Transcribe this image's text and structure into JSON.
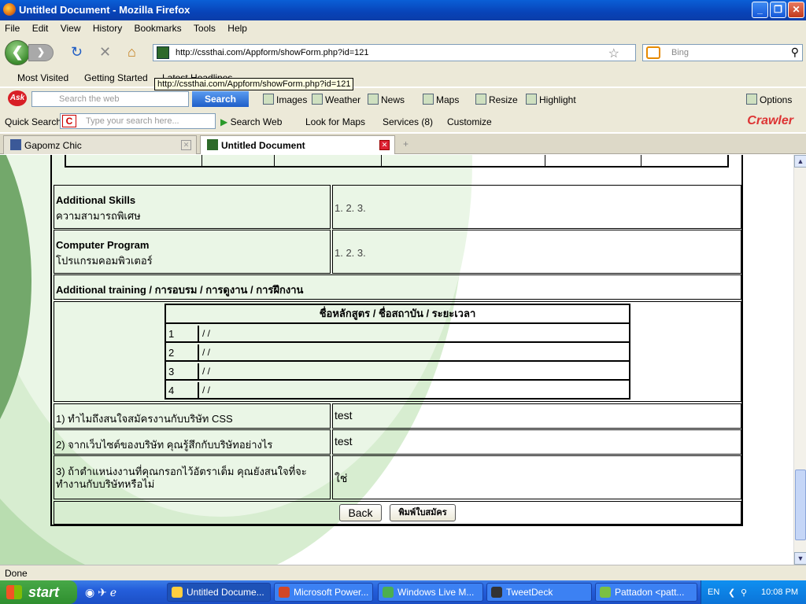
{
  "window": {
    "title": "Untitled Document - Mozilla Firefox"
  },
  "menu": [
    "File",
    "Edit",
    "View",
    "History",
    "Bookmarks",
    "Tools",
    "Help"
  ],
  "nav": {
    "url": "http://cssthai.com/Appform/showForm.php?id=121",
    "search_placeholder": "Bing"
  },
  "bookmarks": {
    "most_visited": "Most Visited",
    "getting_started": "Getting Started",
    "latest_headlines": "Latest Headlines"
  },
  "tooltip": "http://cssthai.com/Appform/showForm.php?id=121",
  "ask_toolbar": {
    "placeholder": "Search the web",
    "search_button": "Search",
    "items": [
      "Images",
      "Weather",
      "News",
      "Maps",
      "Resize",
      "Highlight",
      "Options"
    ]
  },
  "quick_search": {
    "label": "Quick Search:",
    "placeholder": "Type your search here...",
    "items": [
      "Search Web",
      "Look for Maps",
      "Services (8)",
      "Customize"
    ],
    "brand": "Crawler"
  },
  "tabs": [
    {
      "label": "Gapomz Chic",
      "active": false
    },
    {
      "label": "Untitled Document",
      "active": true
    }
  ],
  "form": {
    "additional_skills": {
      "label_en": "Additional Skills",
      "label_th": "ความสามารถพิเศษ",
      "value": "1. 2. 3."
    },
    "computer_program": {
      "label_en": "Computer Program",
      "label_th": "โปรแกรมคอมพิวเตอร์",
      "value": "1. 2. 3."
    },
    "training": {
      "heading": "Additional training / การอบรม / การดูงาน / การฝึกงาน",
      "table_header": "ชื่อหลักสูตร / ชื่อสถาบัน / ระยะเวลา",
      "rows": [
        {
          "num": "1",
          "value": "/ /"
        },
        {
          "num": "2",
          "value": "/ /"
        },
        {
          "num": "3",
          "value": "/ /"
        },
        {
          "num": "4",
          "value": "/ /"
        }
      ]
    },
    "questions": [
      {
        "q": "1) ทำไมถึงสนใจสมัครงานกับบริษัท CSS",
        "a": "test"
      },
      {
        "q": "2) จากเว็บไซต์ของบริษัท คุณรู้สึกกับบริษัทอย่างไร",
        "a": "test"
      },
      {
        "q": "3) ถ้าตำแหน่งงานที่คุณกรอกไว้อัตราเต็ม คุณยังสนใจที่จะทำงานกับบริษัทหรือไม่",
        "a": "ใช่"
      }
    ],
    "back_button": "Back",
    "print_button": "พิมพ์ใบสมัคร"
  },
  "status": "Done",
  "taskbar": {
    "start": "start",
    "items": [
      "Untitled Docume...",
      "Microsoft Power...",
      "Windows Live M...",
      "TweetDeck",
      "Pattadon <patt..."
    ],
    "lang": "EN",
    "time": "10:08 PM"
  }
}
